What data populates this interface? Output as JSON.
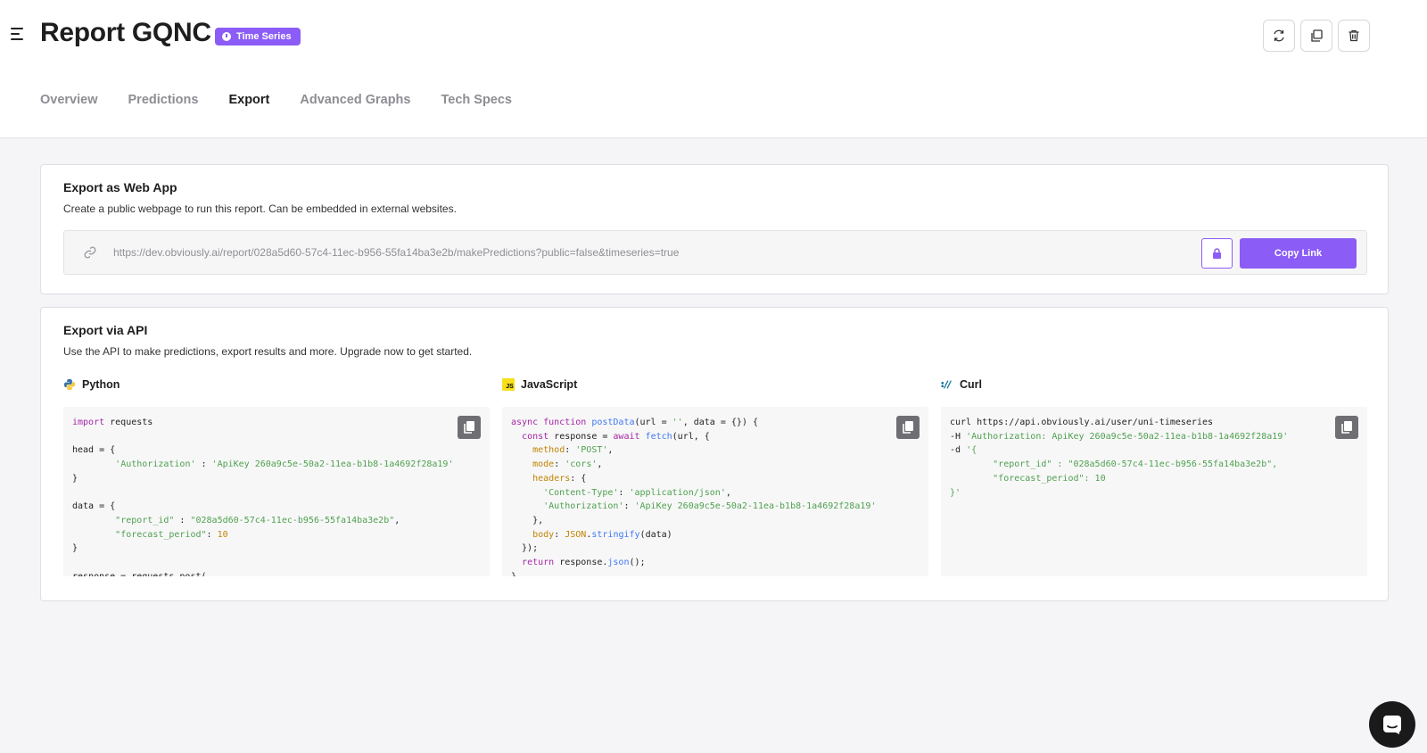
{
  "header": {
    "title": "Report GQNC",
    "badge": "Time Series",
    "actions": [
      "refresh-icon",
      "duplicate-icon",
      "trash-icon"
    ]
  },
  "tabs": [
    {
      "label": "Overview",
      "active": false
    },
    {
      "label": "Predictions",
      "active": false
    },
    {
      "label": "Export",
      "active": true
    },
    {
      "label": "Advanced Graphs",
      "active": false
    },
    {
      "label": "Tech Specs",
      "active": false
    }
  ],
  "web_app": {
    "title": "Export as Web App",
    "description": "Create a public webpage to run this report. Can be embedded in external websites.",
    "url": "https://dev.obviously.ai/report/028a5d60-57c4-11ec-b956-55fa14ba3e2b/makePredictions?public=false&timeseries=true",
    "copy_label": "Copy Link"
  },
  "api": {
    "title": "Export via API",
    "description": "Use the API to make predictions, export results and more. Upgrade now to get started.",
    "languages": [
      {
        "name": "Python"
      },
      {
        "name": "JavaScript"
      },
      {
        "name": "Curl"
      }
    ]
  },
  "colors": {
    "accent": "#8b5cf6",
    "keyword": "#a626a4",
    "string": "#50a14f",
    "number": "#c18401",
    "function": "#4078f2"
  }
}
